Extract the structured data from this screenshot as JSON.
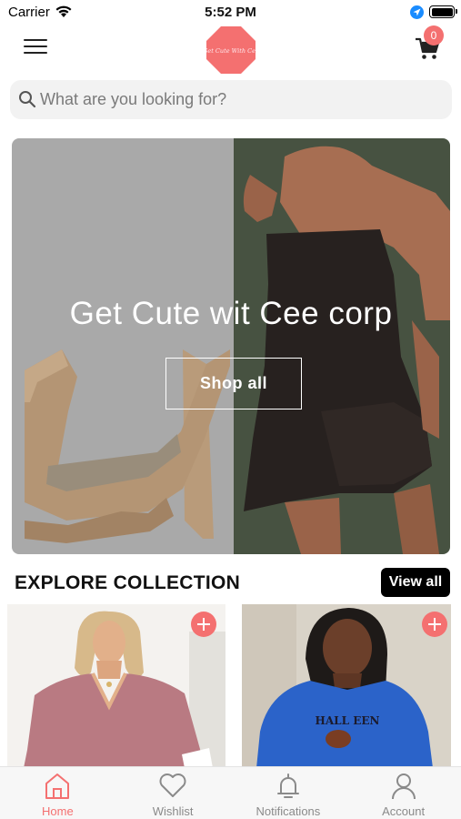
{
  "status_bar": {
    "carrier": "Carrier",
    "time": "5:52 PM"
  },
  "header": {
    "logo_text": "Get Cute With Cee",
    "cart_count": "0"
  },
  "search": {
    "placeholder": "What are you looking for?"
  },
  "hero": {
    "title": "Get Cute wit Cee corp",
    "button_label": "Shop all"
  },
  "collection": {
    "title": "EXPLORE COLLECTION",
    "view_all_label": "View all"
  },
  "tabs": [
    {
      "label": "Home",
      "icon": "home-icon",
      "active": true
    },
    {
      "label": "Wishlist",
      "icon": "heart-icon",
      "active": false
    },
    {
      "label": "Notifications",
      "icon": "bell-icon",
      "active": false
    },
    {
      "label": "Account",
      "icon": "user-icon",
      "active": false
    }
  ],
  "colors": {
    "accent": "#f47070",
    "search_bg": "#f2f2f2",
    "tabbar_bg": "#f7f7f7"
  }
}
